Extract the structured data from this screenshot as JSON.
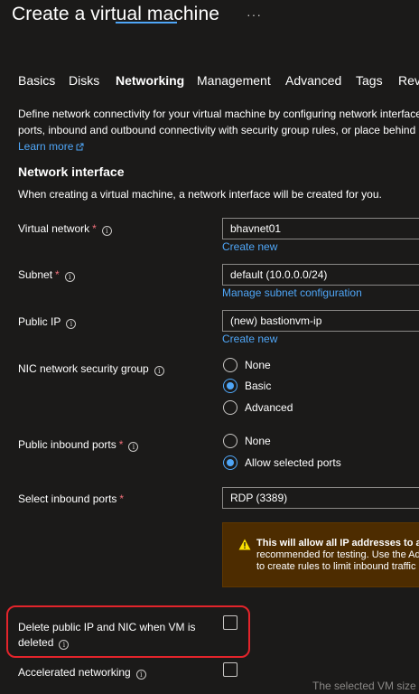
{
  "header": {
    "title": "Create a virtual machine",
    "more": "···"
  },
  "tabs": [
    "Basics",
    "Disks",
    "Networking",
    "Management",
    "Advanced",
    "Tags",
    "Revi"
  ],
  "active_tab": "Networking",
  "description": {
    "line1": "Define network connectivity for your virtual machine by configuring network interface",
    "line2": "ports, inbound and outbound connectivity with security group rules, or place behind a",
    "learn_more": "Learn more"
  },
  "network_interface": {
    "heading": "Network interface",
    "subtext": "When creating a virtual machine, a network interface will be created for you."
  },
  "fields": {
    "virtual_network": {
      "label": "Virtual network",
      "required": "*",
      "value": "bhavnet01",
      "link": "Create new"
    },
    "subnet": {
      "label": "Subnet",
      "required": "*",
      "value": "default (10.0.0.0/24)",
      "link": "Manage subnet configuration"
    },
    "public_ip": {
      "label": "Public IP",
      "value": "(new) bastionvm-ip",
      "link": "Create new"
    },
    "nic_nsg": {
      "label": "NIC network security group",
      "options": [
        "None",
        "Basic",
        "Advanced"
      ],
      "selected": "Basic"
    },
    "public_inbound": {
      "label": "Public inbound ports",
      "required": "*",
      "options": [
        "None",
        "Allow selected ports"
      ],
      "selected": "Allow selected ports"
    },
    "select_inbound": {
      "label": "Select inbound ports",
      "required": "*",
      "value": "RDP (3389)"
    },
    "delete_ip_nic": {
      "label_line1": "Delete public IP and NIC when VM is",
      "label_line2": "deleted",
      "checked": false
    },
    "accelerated": {
      "label": "Accelerated networking",
      "checked": false
    }
  },
  "warning": {
    "line1": "This will allow all IP addresses to ac",
    "line2": "recommended for testing.  Use the Ad",
    "line3": "to create rules to limit inbound traffic"
  },
  "footnote": "The selected VM size d",
  "colors": {
    "background": "#1b1a19",
    "accent": "#4fa6f7",
    "required": "#f1707b",
    "warning_bg": "#4d2c00",
    "warning_icon": "#fce100",
    "highlight": "#e3242b"
  },
  "icons": {
    "info": "info-icon",
    "warning": "warning-icon",
    "external_link": "external-link-icon",
    "more": "more-icon"
  }
}
